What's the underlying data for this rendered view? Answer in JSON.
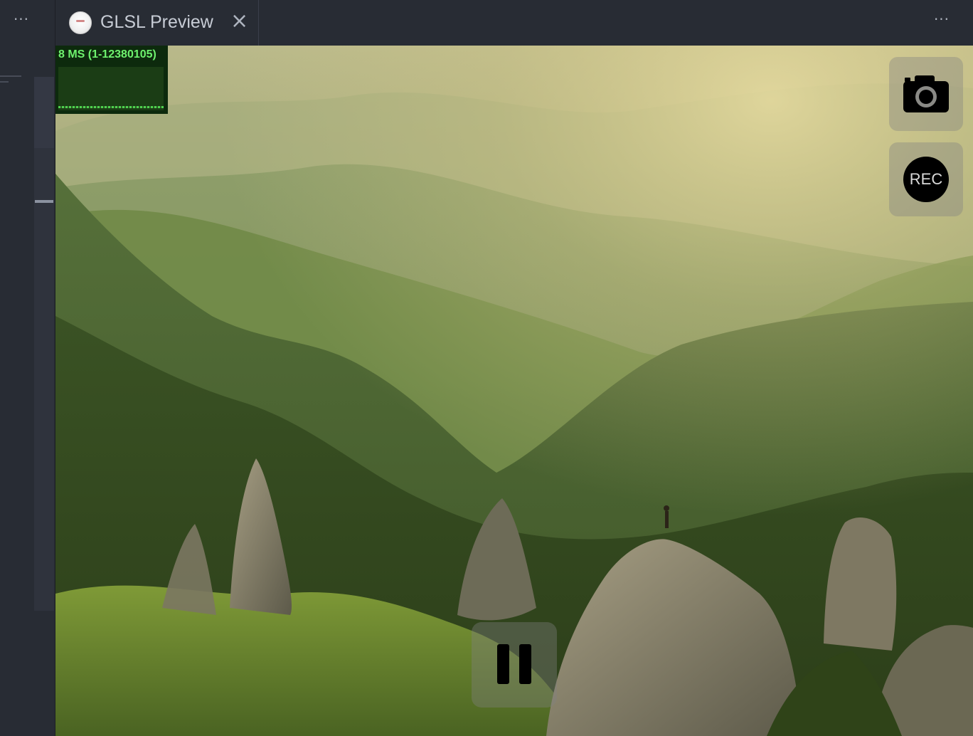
{
  "left_pane": {
    "more_label": "···",
    "minimap_lines": [
      "attribute vec2",
      "uv;"
    ]
  },
  "tab": {
    "title": "GLSL Preview",
    "close_label": "×",
    "icon": "app-logo-icon"
  },
  "header": {
    "more_label": "···"
  },
  "stats": {
    "label": "8 MS (1-12380105)"
  },
  "controls": {
    "rec_label": "REC",
    "capture_icon": "camera-icon",
    "pause_icon": "pause-icon"
  },
  "colors": {
    "editor_bg": "#282c34",
    "stats_text": "#6ef26e",
    "stats_bg": "#0d2a0d"
  }
}
